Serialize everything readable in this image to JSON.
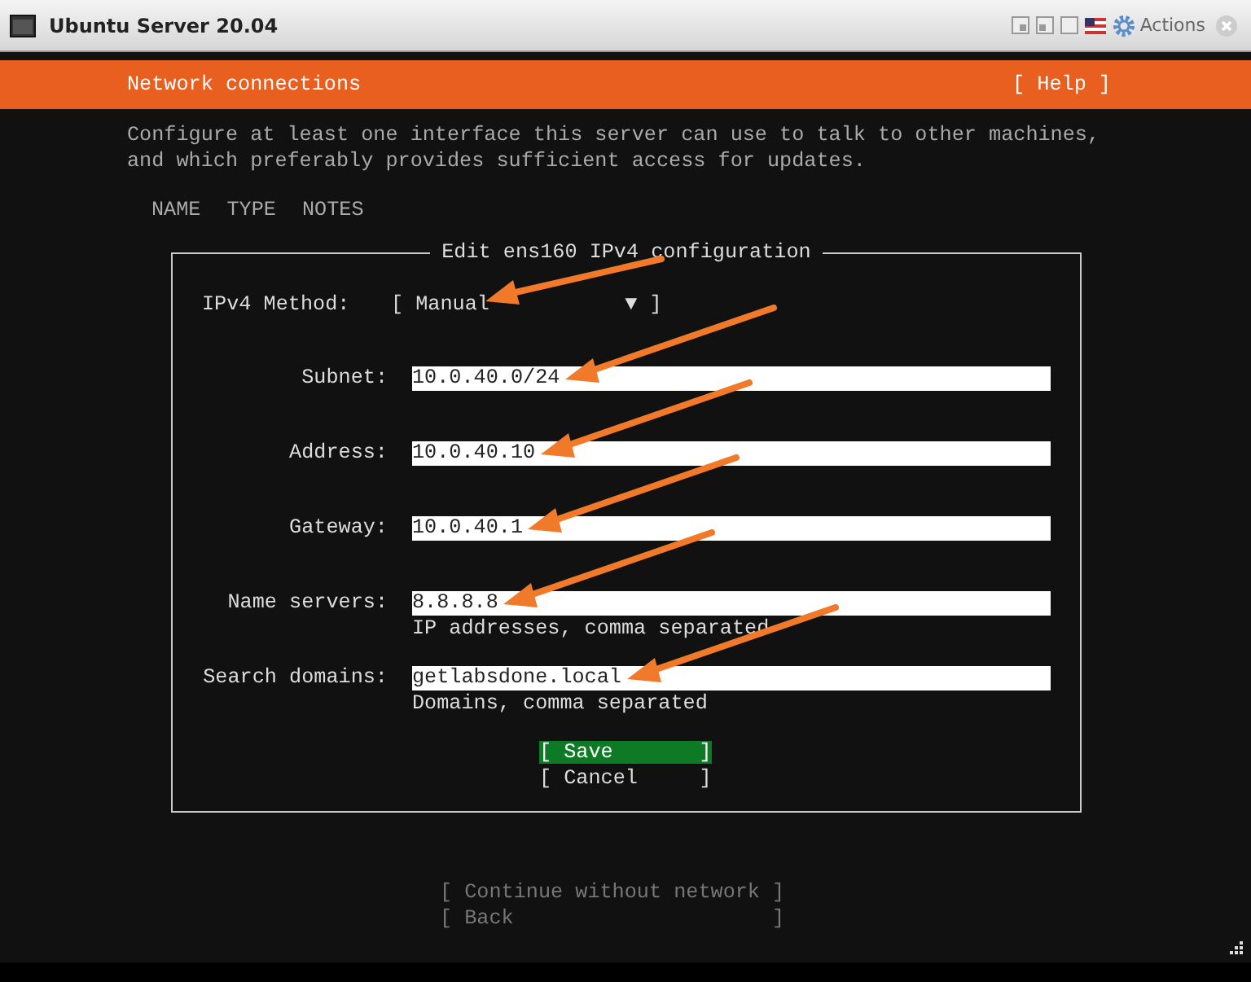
{
  "window": {
    "title": "Ubuntu Server 20.04",
    "actions": "Actions"
  },
  "header": {
    "title": "Network connections",
    "help": "[ Help ]"
  },
  "intro": "Configure at least one interface this server can use to talk to other machines,\nand which preferably provides sufficient access for updates.",
  "columns": [
    "NAME",
    "TYPE",
    "NOTES"
  ],
  "dialog": {
    "title": "Edit ens160 IPv4 configuration",
    "method": {
      "label": "IPv4 Method:",
      "value": "[ Manual           ▼ ]",
      "arrow": true
    },
    "fields": [
      {
        "label": "Subnet:",
        "value": "10.0.40.0/24",
        "arrow": true
      },
      {
        "label": "Address:",
        "value": "10.0.40.10",
        "arrow": true
      },
      {
        "label": "Gateway:",
        "value": "10.0.40.1",
        "arrow": true
      },
      {
        "label": "Name servers:",
        "value": "8.8.8.8",
        "hint": "IP addresses, comma separated",
        "arrow": true
      },
      {
        "label": "Search domains:",
        "value": "getlabsdone.local",
        "hint": "Domains, comma separated",
        "arrow": true
      }
    ],
    "buttons": [
      {
        "label": "[ Save       ]",
        "selected": true
      },
      {
        "label": "[ Cancel     ]",
        "selected": false
      }
    ]
  },
  "footer_buttons": [
    {
      "label": "[ Continue without network ]"
    },
    {
      "label": "[ Back                     ]"
    }
  ]
}
